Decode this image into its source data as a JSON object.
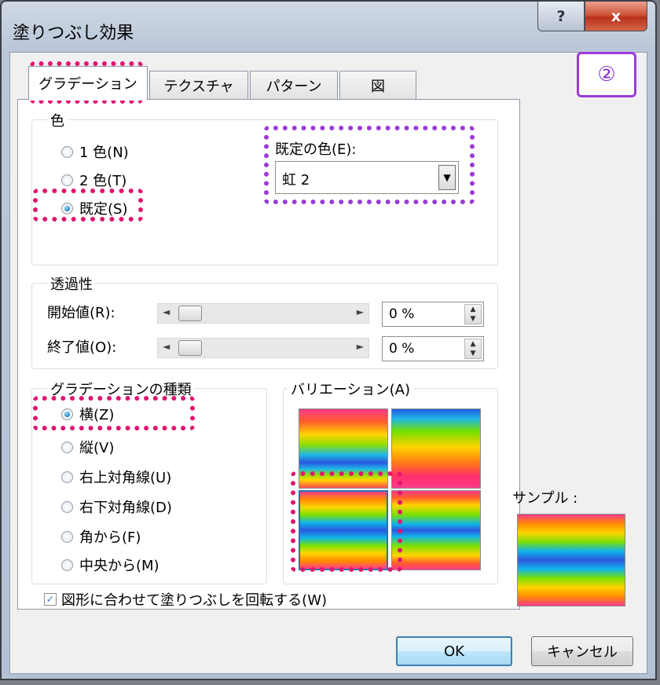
{
  "window": {
    "title": "塗りつぶし効果",
    "help_label": "?",
    "close_label": "x"
  },
  "tabs": [
    {
      "label": "グラデーション"
    },
    {
      "label": "テクスチャ"
    },
    {
      "label": "パターン"
    },
    {
      "label": "図"
    }
  ],
  "annotation_badge": "②",
  "color_group": {
    "label": "色",
    "options": [
      {
        "label": "1 色(N)",
        "selected": false
      },
      {
        "label": "2 色(T)",
        "selected": false
      },
      {
        "label": "既定(S)",
        "selected": true
      }
    ],
    "preset_label": "既定の色(E):",
    "preset_value": "虹 2"
  },
  "transparency": {
    "label": "透過性",
    "start_label": "開始値(R):",
    "start_value": "0 %",
    "end_label": "終了値(O):",
    "end_value": "0 %"
  },
  "shading": {
    "label": "グラデーションの種類",
    "options": [
      {
        "label": "横(Z)",
        "selected": true
      },
      {
        "label": "縦(V)",
        "selected": false
      },
      {
        "label": "右上対角線(U)",
        "selected": false
      },
      {
        "label": "右下対角線(D)",
        "selected": false
      },
      {
        "label": "角から(F)",
        "selected": false
      },
      {
        "label": "中央から(M)",
        "selected": false
      }
    ]
  },
  "variants": {
    "label": "バリエーション(A)",
    "selected_index": 2
  },
  "sample_label": "サンプル :",
  "rotate_checkbox": {
    "label": "図形に合わせて塗りつぶしを回転する(W)",
    "checked": true,
    "mark": "✓"
  },
  "buttons": {
    "ok": "OK",
    "cancel": "キャンセル"
  },
  "colors": {
    "annotation_pink": "#e0156f",
    "annotation_purple": "#9b3ad8"
  }
}
